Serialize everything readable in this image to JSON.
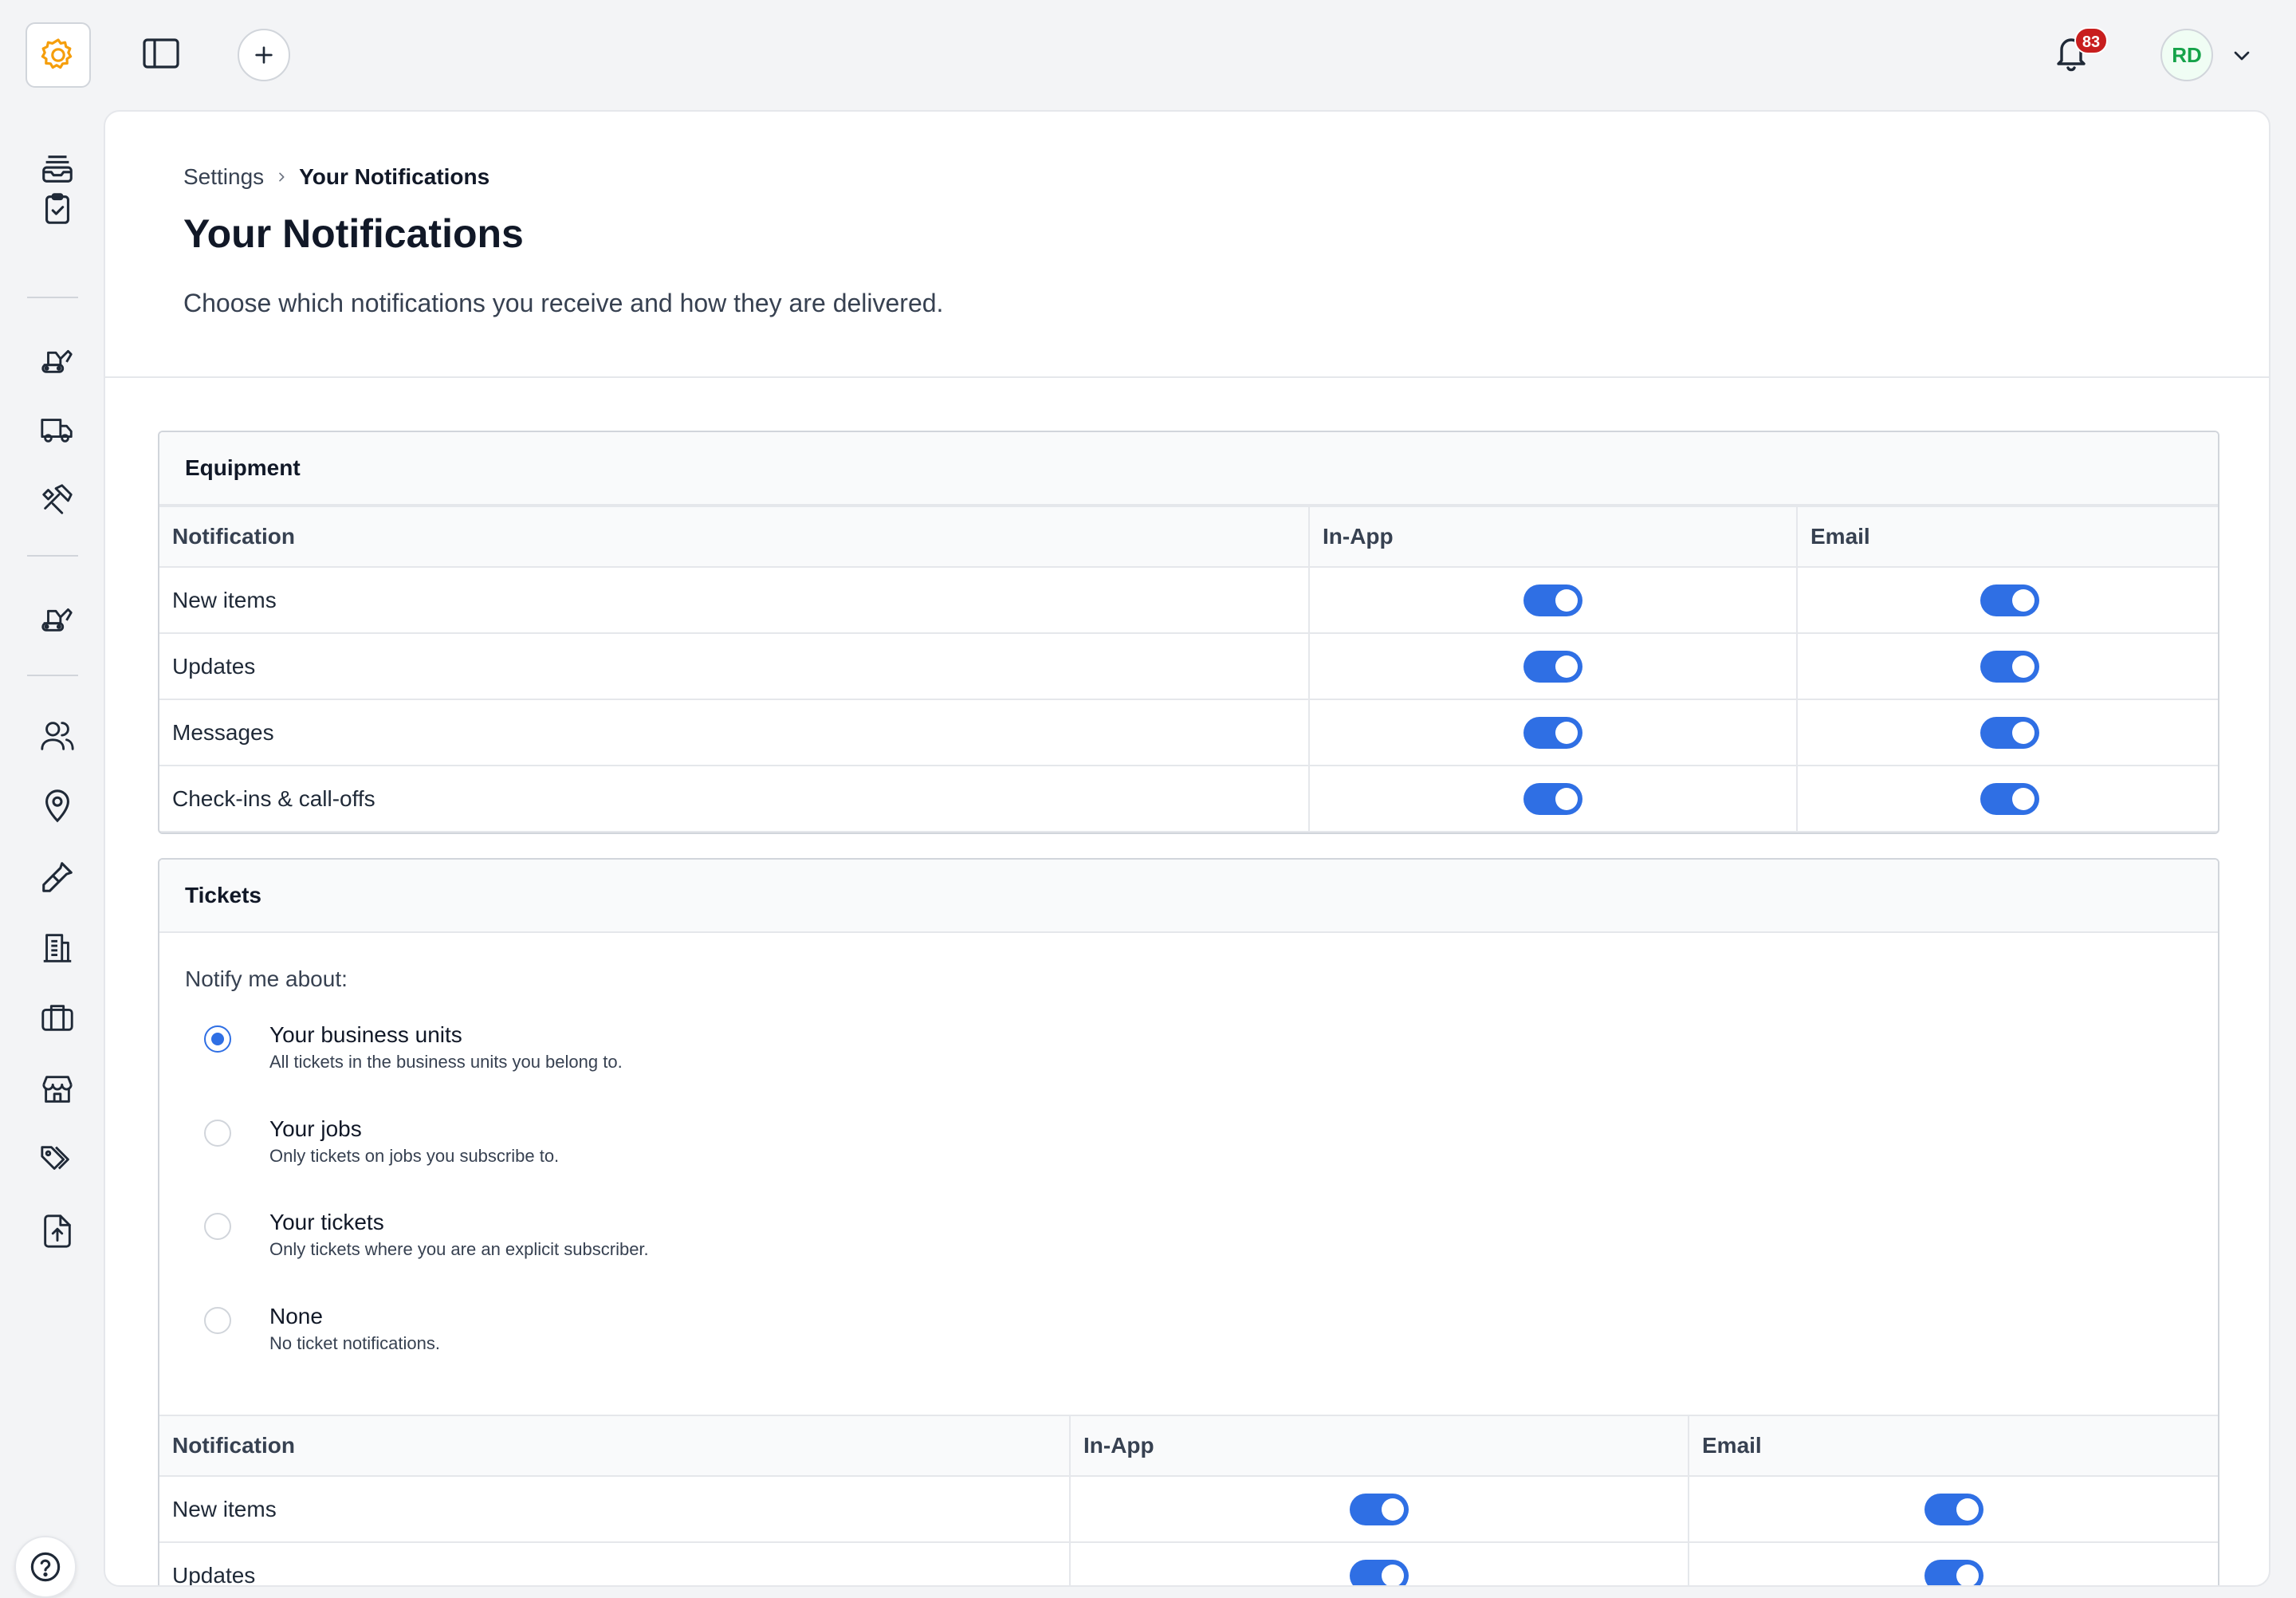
{
  "colors": {
    "accent": "#2f6fe4",
    "logo": "#f59e0b",
    "badge": "#c81e1e",
    "avatar_text": "#16a34a"
  },
  "topbar": {
    "logo_icon": "gear-icon",
    "notifications_count": "83",
    "avatar_initials": "RD"
  },
  "sidebar": {
    "items": [
      {
        "icon": "inbox-stack-icon"
      },
      {
        "icon": "clipboard-check-icon"
      },
      {
        "icon": "excavator-icon"
      },
      {
        "icon": "truck-icon"
      },
      {
        "icon": "hammer-wrench-icon"
      },
      {
        "icon": "excavator-icon"
      },
      {
        "icon": "users-icon"
      },
      {
        "icon": "map-pin-icon"
      },
      {
        "icon": "eyedropper-icon"
      },
      {
        "icon": "building-icon"
      },
      {
        "icon": "briefcase-icon"
      },
      {
        "icon": "storefront-icon"
      },
      {
        "icon": "tags-icon"
      },
      {
        "icon": "file-upload-icon"
      }
    ],
    "help_icon": "question-icon"
  },
  "breadcrumb": {
    "parent": "Settings",
    "current": "Your Notifications"
  },
  "page": {
    "title": "Your Notifications",
    "description": "Choose which notifications you receive and how they are delivered."
  },
  "equipment": {
    "title": "Equipment",
    "columns": [
      "Notification",
      "In-App",
      "Email"
    ],
    "rows": [
      {
        "label": "New items",
        "in_app": true,
        "email": true
      },
      {
        "label": "Updates",
        "in_app": true,
        "email": true
      },
      {
        "label": "Messages",
        "in_app": true,
        "email": true
      },
      {
        "label": "Check-ins & call-offs",
        "in_app": true,
        "email": true
      }
    ]
  },
  "tickets": {
    "title": "Tickets",
    "notify_label": "Notify me about:",
    "options": [
      {
        "title": "Your business units",
        "subtitle": "All tickets in the business units you belong to.",
        "selected": true
      },
      {
        "title": "Your jobs",
        "subtitle": "Only tickets on jobs you subscribe to.",
        "selected": false
      },
      {
        "title": "Your tickets",
        "subtitle": "Only tickets where you are an explicit subscriber.",
        "selected": false
      },
      {
        "title": "None",
        "subtitle": "No ticket notifications.",
        "selected": false
      }
    ],
    "columns": [
      "Notification",
      "In-App",
      "Email"
    ],
    "rows": [
      {
        "label": "New items",
        "in_app": true,
        "email": true
      },
      {
        "label": "Updates",
        "in_app": true,
        "email": true
      }
    ]
  }
}
